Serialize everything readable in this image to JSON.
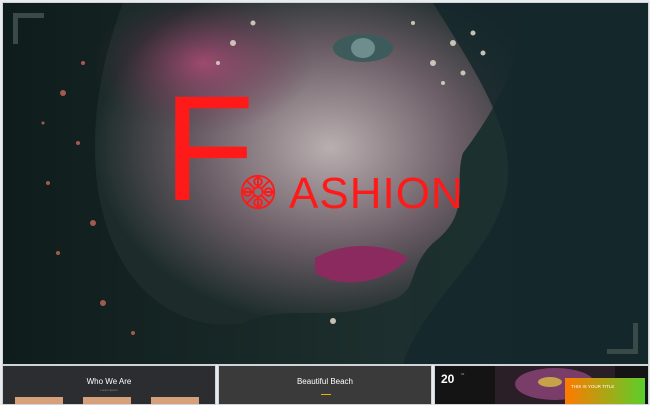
{
  "hero": {
    "big_letter": "F",
    "rest_word": "ASHION",
    "accent_color": "#ff1a1a",
    "rosette_icon": "rosette-icon"
  },
  "thumbnails": [
    {
      "title": "Who We Are",
      "subtitle": "Lorem Ipsum"
    },
    {
      "title": "Beautiful Beach",
      "subtitle": ""
    },
    {
      "number": "20",
      "superscript": "02",
      "badge_title": "THIS IS YOUR TITLE"
    }
  ]
}
